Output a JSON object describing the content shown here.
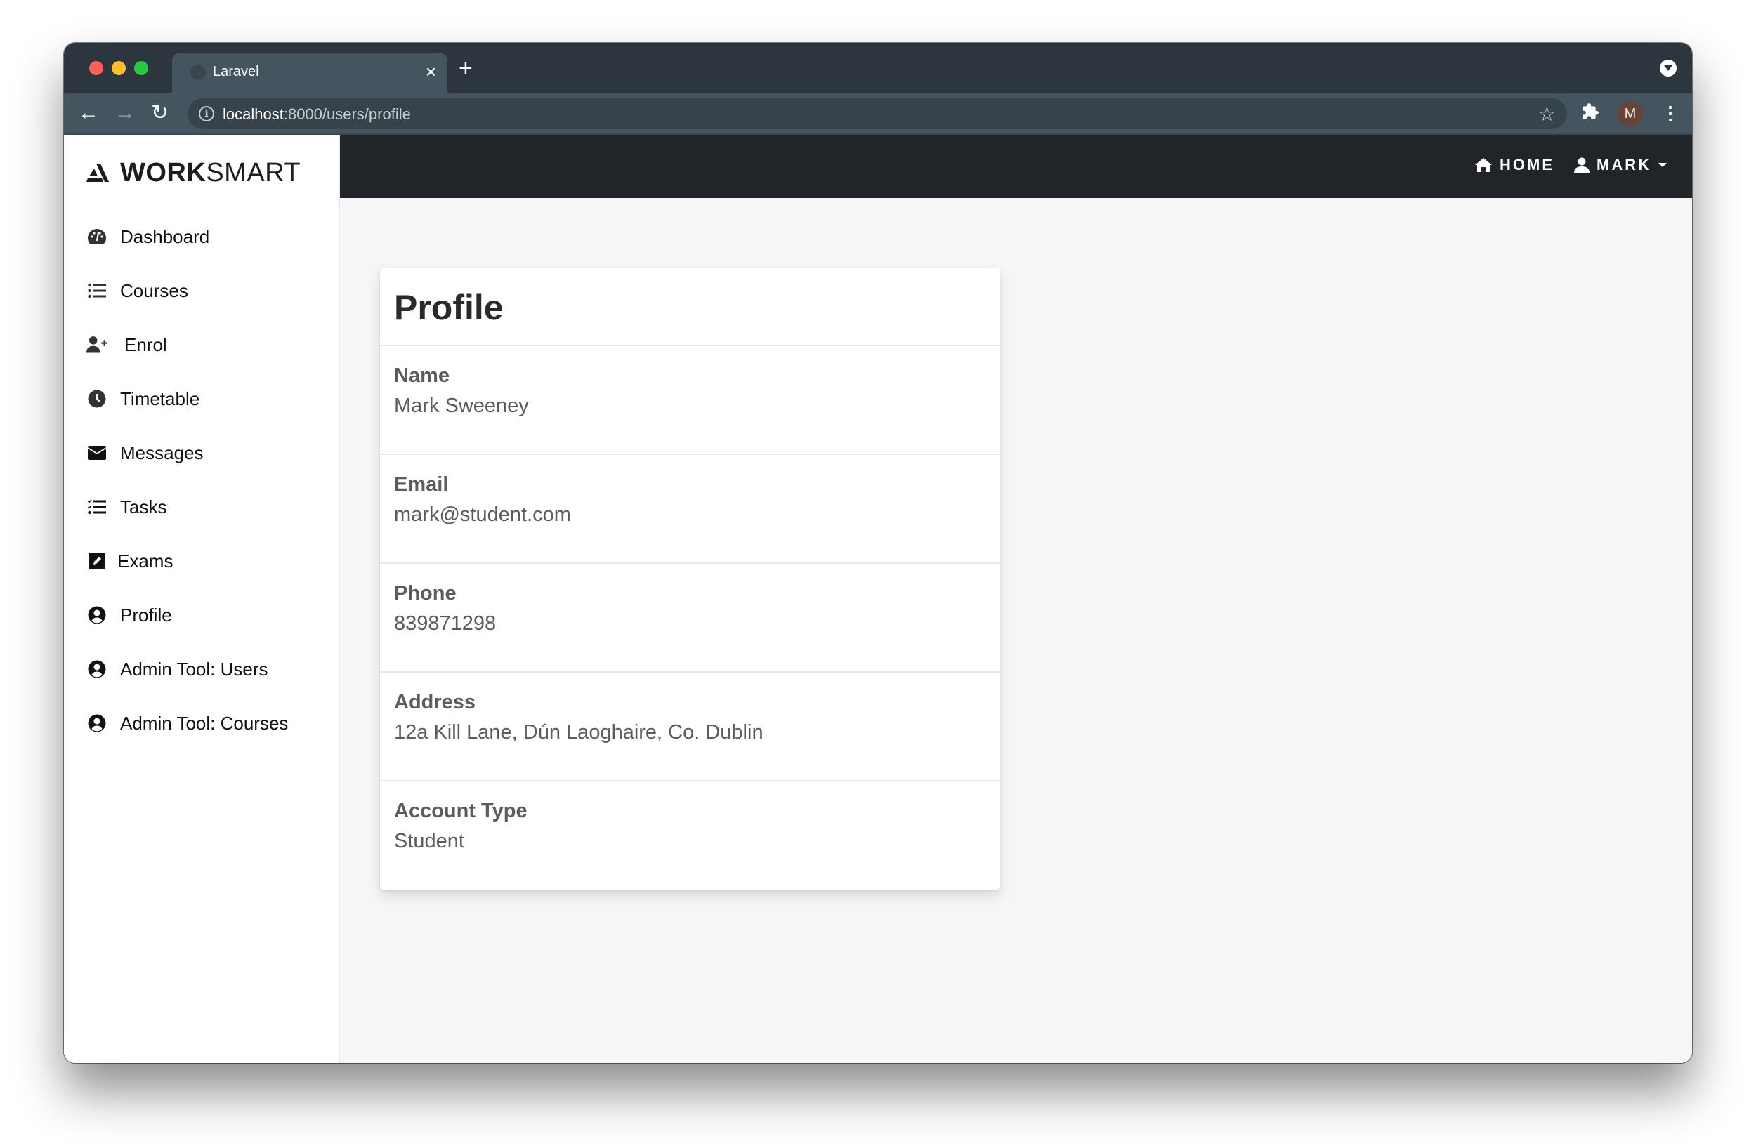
{
  "browser": {
    "tab_title": "Laravel",
    "tab_close": "×",
    "new_tab": "+",
    "url_host": "localhost",
    "url_rest": ":8000/users/profile",
    "profile_initial": "M",
    "nav_back": "←",
    "nav_forward": "→",
    "nav_reload": "↻",
    "star": "☆",
    "kebab": "⋮",
    "info": "i"
  },
  "brand": {
    "bold": "WORK",
    "light": "SMART"
  },
  "sidebar": {
    "items": [
      {
        "label": "Dashboard",
        "icon": "tachometer-icon"
      },
      {
        "label": "Courses",
        "icon": "list-icon"
      },
      {
        "label": "Enrol",
        "icon": "user-plus-icon"
      },
      {
        "label": "Timetable",
        "icon": "clock-icon"
      },
      {
        "label": "Messages",
        "icon": "envelope-icon"
      },
      {
        "label": "Tasks",
        "icon": "tasks-icon"
      },
      {
        "label": "Exams",
        "icon": "edit-icon"
      },
      {
        "label": "Profile",
        "icon": "user-circle-icon"
      },
      {
        "label": "Admin Tool: Users",
        "icon": "user-circle-icon"
      },
      {
        "label": "Admin Tool: Courses",
        "icon": "user-circle-icon"
      }
    ]
  },
  "topnav": {
    "home": "HOME",
    "user": "MARK"
  },
  "profile": {
    "title": "Profile",
    "fields": [
      {
        "label": "Name",
        "value": "Mark Sweeney"
      },
      {
        "label": "Email",
        "value": "mark@student.com"
      },
      {
        "label": "Phone",
        "value": "839871298"
      },
      {
        "label": "Address",
        "value": "12a Kill Lane, Dún Laoghaire, Co. Dublin"
      },
      {
        "label": "Account Type",
        "value": "Student"
      }
    ]
  }
}
